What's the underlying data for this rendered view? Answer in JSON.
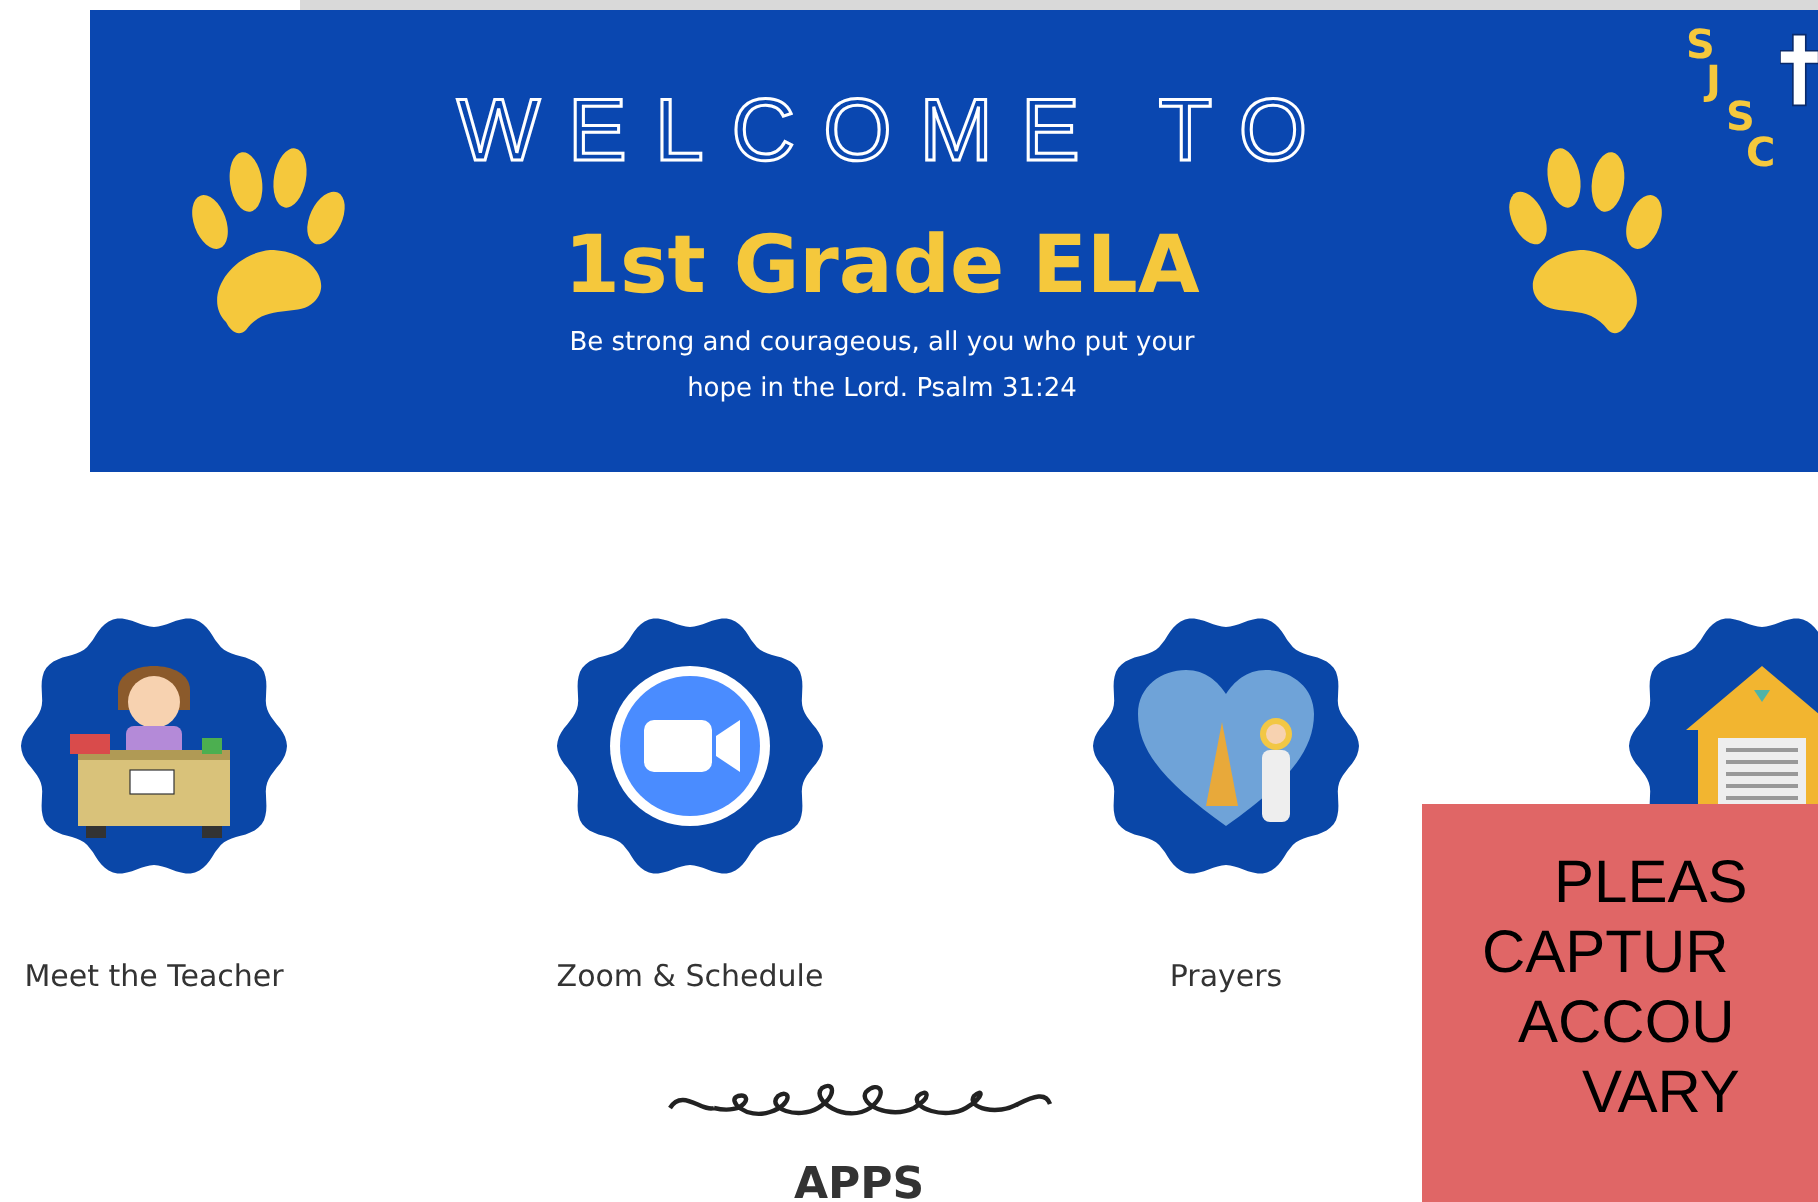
{
  "banner": {
    "heading": "WELCOME TO",
    "title": "1st Grade ELA",
    "verse_lines": [
      "Be strong and courageous, all you who put your",
      "hope in the Lord.  Psalm 31:24"
    ],
    "logo_letters": [
      "S",
      "J",
      "S",
      "C"
    ]
  },
  "tiles": [
    {
      "kind": "teacher",
      "label": "Meet the Teacher"
    },
    {
      "kind": "video",
      "label": "Zoom & Schedule"
    },
    {
      "kind": "prayer",
      "label": "Prayers"
    },
    {
      "kind": "house"
    }
  ],
  "section_title": "APPS",
  "notice_lines": [
    "PLEAS",
    "CAPTUR",
    "ACCOU",
    "VARY"
  ]
}
